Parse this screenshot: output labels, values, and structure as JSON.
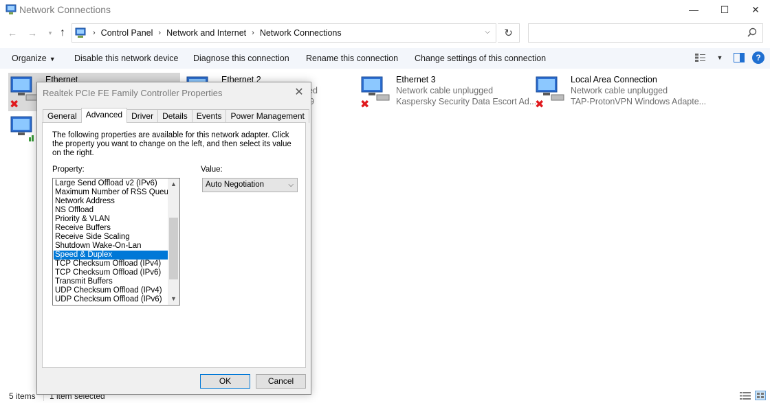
{
  "window": {
    "title": "Network Connections"
  },
  "address": {
    "crumbs": [
      "Control Panel",
      "Network and Internet",
      "Network Connections"
    ]
  },
  "search": {
    "placeholder": ""
  },
  "toolbar": {
    "organize": "Organize",
    "disable": "Disable this network device",
    "diagnose": "Diagnose this connection",
    "rename": "Rename this connection",
    "change": "Change settings of this connection"
  },
  "connections": [
    {
      "name": "Ethernet",
      "status": "",
      "adapter": ""
    },
    {
      "name": "Ethernet 2",
      "status": "ed",
      "adapter": "9"
    },
    {
      "name": "Ethernet 3",
      "status": "Network cable unplugged",
      "adapter": "Kaspersky Security Data Escort Ad..."
    },
    {
      "name": "Local Area Connection",
      "status": "Network cable unplugged",
      "adapter": "TAP-ProtonVPN Windows Adapte..."
    }
  ],
  "statusbar": {
    "items": "5 items",
    "selected": "1 item selected"
  },
  "dialog": {
    "title": "Realtek PCIe FE Family Controller Properties",
    "tabs": [
      "General",
      "Advanced",
      "Driver",
      "Details",
      "Events",
      "Power Management"
    ],
    "active_tab": "Advanced",
    "description": "The following properties are available for this network adapter. Click the property you want to change on the left, and then select its value on the right.",
    "property_label": "Property:",
    "value_label": "Value:",
    "properties": [
      "Large Send Offload v2 (IPv6)",
      "Maximum Number of RSS Queues",
      "Network Address",
      "NS Offload",
      "Priority & VLAN",
      "Receive Buffers",
      "Receive Side Scaling",
      "Shutdown Wake-On-Lan",
      "Speed & Duplex",
      "TCP Checksum Offload (IPv4)",
      "TCP Checksum Offload (IPv6)",
      "Transmit Buffers",
      "UDP Checksum Offload (IPv4)",
      "UDP Checksum Offload (IPv6)"
    ],
    "selected_property": "Speed & Duplex",
    "value": "Auto Negotiation",
    "ok": "OK",
    "cancel": "Cancel"
  }
}
